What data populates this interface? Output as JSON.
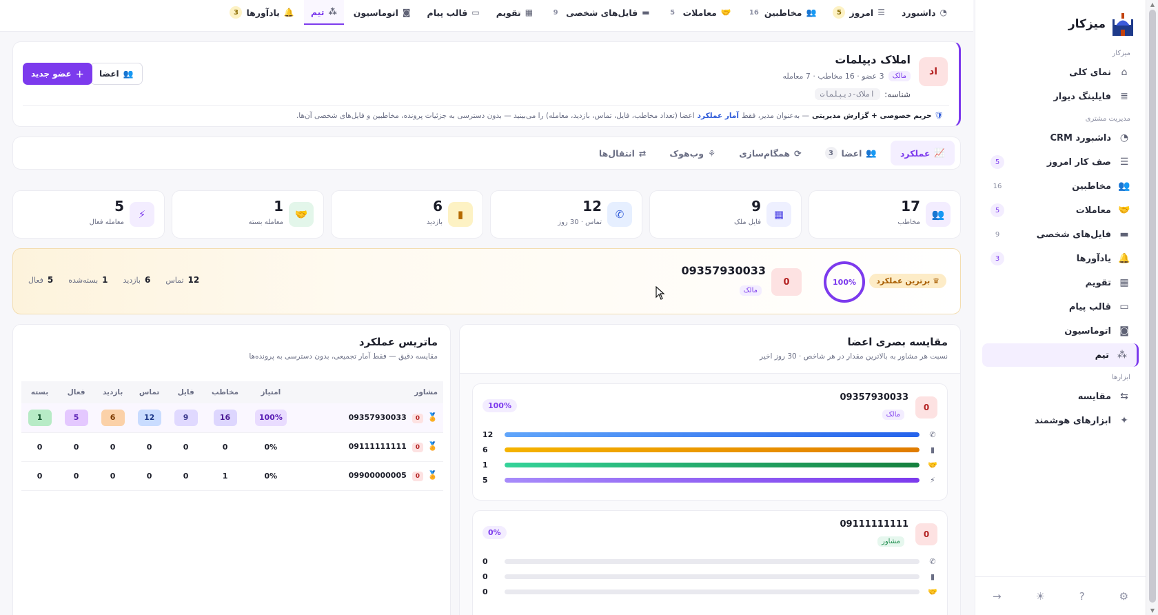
{
  "sidebar": {
    "brand": "میزکار",
    "sections": [
      {
        "title": "میزکار",
        "items": [
          {
            "label": "نمای کلی",
            "icon": "home-icon",
            "count": ""
          },
          {
            "label": "فایلینگ دیوار",
            "icon": "database-icon",
            "count": ""
          }
        ]
      },
      {
        "title": "مدیریت مشتری",
        "items": [
          {
            "label": "داشبورد CRM",
            "icon": "pie-chart-icon",
            "count": ""
          },
          {
            "label": "صف کار امروز",
            "icon": "checklist-icon",
            "count": "5"
          },
          {
            "label": "مخاطبین",
            "icon": "users-icon",
            "count": "16"
          },
          {
            "label": "معاملات",
            "icon": "handshake-icon",
            "count": "5"
          },
          {
            "label": "فایل‌های شخصی",
            "icon": "folder-icon",
            "count": "9"
          },
          {
            "label": "یادآورها",
            "icon": "bell-icon",
            "count": "3"
          },
          {
            "label": "تقویم",
            "icon": "calendar-icon",
            "count": ""
          },
          {
            "label": "قالب پیام",
            "icon": "message-icon",
            "count": ""
          },
          {
            "label": "اتوماسیون",
            "icon": "robot-icon",
            "count": ""
          },
          {
            "label": "تیم",
            "icon": "team-icon",
            "count": "",
            "active": true
          }
        ]
      },
      {
        "title": "ابزارها",
        "items": [
          {
            "label": "مقایسه",
            "icon": "compare-icon",
            "count": ""
          },
          {
            "label": "ابزارهای هوشمند",
            "icon": "magic-wand-icon",
            "count": ""
          }
        ]
      }
    ]
  },
  "topnav": [
    {
      "label": "داشبورد",
      "icon": "pie-chart-icon",
      "count": ""
    },
    {
      "label": "امروز",
      "icon": "checklist-icon",
      "count": "5",
      "yellow": true
    },
    {
      "label": "مخاطبین",
      "icon": "users-icon",
      "count": "16"
    },
    {
      "label": "معاملات",
      "icon": "handshake-icon",
      "count": "5"
    },
    {
      "label": "فایل‌های شخصی",
      "icon": "folder-icon",
      "count": "9"
    },
    {
      "label": "تقویم",
      "icon": "calendar-icon",
      "count": ""
    },
    {
      "label": "قالب پیام",
      "icon": "message-icon",
      "count": ""
    },
    {
      "label": "اتوماسیون",
      "icon": "robot-icon",
      "count": ""
    },
    {
      "label": "تیم",
      "icon": "team-icon",
      "count": "",
      "active": true
    },
    {
      "label": "یادآورها",
      "icon": "bell-icon",
      "count": "3",
      "yellow": true
    }
  ],
  "team": {
    "avatar": "اد",
    "name": "املاک دیپلمات",
    "role": "مالک",
    "meta": "3 عضو · 16 مخاطب · 7 معامله",
    "id_label": "شناسه:",
    "id_code": "املاک-دیپلمات",
    "privacy_bold": "حریم خصوصی + گزارش مدیریتی",
    "privacy_mid": "— به‌عنوان مدیر، فقط",
    "privacy_hl": "آمار عملکرد",
    "privacy_rest": "اعضا (تعداد مخاطب، فایل، تماس، بازدید، معامله) را می‌بینید — بدون دسترسی به جزئیات پرونده، مخاطبین و فایل‌های شخصی آن‌ها.",
    "btn_new": "عضو جدید",
    "btn_members": "اعضا"
  },
  "tabs": [
    {
      "label": "عملکرد",
      "icon": "chart-line-icon",
      "count": "",
      "active": true
    },
    {
      "label": "اعضا",
      "icon": "users-icon",
      "count": "3"
    },
    {
      "label": "همگام‌سازی",
      "icon": "sync-icon",
      "count": ""
    },
    {
      "label": "وب‌هوک",
      "icon": "webhook-icon",
      "count": ""
    },
    {
      "label": "انتقال‌ها",
      "icon": "transfer-icon",
      "count": ""
    }
  ],
  "stats": [
    {
      "value": "17",
      "label": "مخاطب",
      "icon": "users-icon",
      "bg": "#f3edff",
      "fg": "#7c3aed",
      "glyph": "👥"
    },
    {
      "value": "9",
      "label": "فایل ملک",
      "icon": "building-icon",
      "bg": "#eef0ff",
      "fg": "#4f46e5",
      "glyph": "▦"
    },
    {
      "value": "12",
      "label": "تماس · 30 روز",
      "icon": "phone-icon",
      "bg": "#e6efff",
      "fg": "#2f5bd8",
      "glyph": "✆"
    },
    {
      "value": "6",
      "label": "بازدید",
      "icon": "door-icon",
      "bg": "#fdf2c4",
      "fg": "#b56a00",
      "glyph": "▮"
    },
    {
      "value": "1",
      "label": "معامله بسته",
      "icon": "handshake-icon",
      "bg": "#e3f6ea",
      "fg": "#1f8d4d",
      "glyph": "🤝"
    },
    {
      "value": "5",
      "label": "معامله فعال",
      "icon": "bolt-icon",
      "bg": "#f3edff",
      "fg": "#7c3aed",
      "glyph": "⚡"
    }
  ],
  "top_performer": {
    "badge": "برترین عملکرد",
    "percent": "100%",
    "score": "0",
    "name": "09357930033",
    "role": "مالک",
    "stats": [
      {
        "value": "12",
        "label": "تماس"
      },
      {
        "value": "6",
        "label": "بازدید"
      },
      {
        "value": "1",
        "label": "بسته‌شده"
      },
      {
        "value": "5",
        "label": "فعال"
      }
    ]
  },
  "comparison": {
    "title": "مقایسه بصری اعضا",
    "subtitle": "نسبت هر مشاور به بالاترین مقدار در هر شاخص · 30 روز اخیر",
    "members": [
      {
        "name": "09357930033",
        "role": "مالک",
        "role_kind": "owner",
        "score": "0",
        "percent": "100%",
        "bars": [
          {
            "icon": "phone-icon",
            "glyph": "✆",
            "value": "12",
            "ratio": 1,
            "color": "linear-gradient(90deg,#60a5fa,#2563eb)"
          },
          {
            "icon": "door-icon",
            "glyph": "▮",
            "value": "6",
            "ratio": 1,
            "color": "linear-gradient(90deg,#f5b300,#e07b00)"
          },
          {
            "icon": "handshake-icon",
            "glyph": "🤝",
            "value": "1",
            "ratio": 1,
            "color": "linear-gradient(90deg,#34d399,#15803d)"
          },
          {
            "icon": "bolt-icon",
            "glyph": "⚡",
            "value": "5",
            "ratio": 1,
            "color": "linear-gradient(90deg,#a78bfa,#7c3aed)"
          }
        ]
      },
      {
        "name": "09111111111",
        "role": "مشاور",
        "role_kind": "advisor",
        "score": "0",
        "percent": "0%",
        "bars": [
          {
            "icon": "phone-icon",
            "glyph": "✆",
            "value": "0",
            "ratio": 0,
            "color": "#2563eb"
          },
          {
            "icon": "door-icon",
            "glyph": "▮",
            "value": "0",
            "ratio": 0,
            "color": "#e07b00"
          },
          {
            "icon": "handshake-icon",
            "glyph": "🤝",
            "value": "0",
            "ratio": 0,
            "color": "#15803d"
          }
        ]
      }
    ]
  },
  "matrix": {
    "title": "ماتریس عملکرد",
    "subtitle": "مقایسه دقیق — فقط آمار تجمیعی، بدون دسترسی به پرونده‌ها",
    "headers": [
      "مشاور",
      "امتیاز",
      "مخاطب",
      "فایل",
      "تماس",
      "بازدید",
      "فعال",
      "بسته"
    ],
    "rows": [
      {
        "name": "09357930033",
        "score": "0",
        "cells": [
          "100%",
          "16",
          "9",
          "12",
          "6",
          "5",
          "1"
        ],
        "highlight": true
      },
      {
        "name": "09111111111",
        "score": "0",
        "cells": [
          "0%",
          "0",
          "0",
          "0",
          "0",
          "0",
          "0"
        ]
      },
      {
        "name": "09900000005",
        "score": "0",
        "cells": [
          "0%",
          "1",
          "0",
          "0",
          "0",
          "0",
          "0"
        ]
      }
    ],
    "chip_colors": [
      {
        "bg": "#e9dcff",
        "fg": "#5b21b6"
      },
      {
        "bg": "#ddd6fe",
        "fg": "#4c1d95"
      },
      {
        "bg": "#e0d9ff",
        "fg": "#3f3c8f"
      },
      {
        "bg": "#c9dcff",
        "fg": "#1e3a8a"
      },
      {
        "bg": "#fbd1a8",
        "fg": "#7c3a00"
      },
      {
        "bg": "#e4c8ff",
        "fg": "#5b21b6"
      },
      {
        "bg": "#b7ebc6",
        "fg": "#14532d"
      }
    ]
  }
}
